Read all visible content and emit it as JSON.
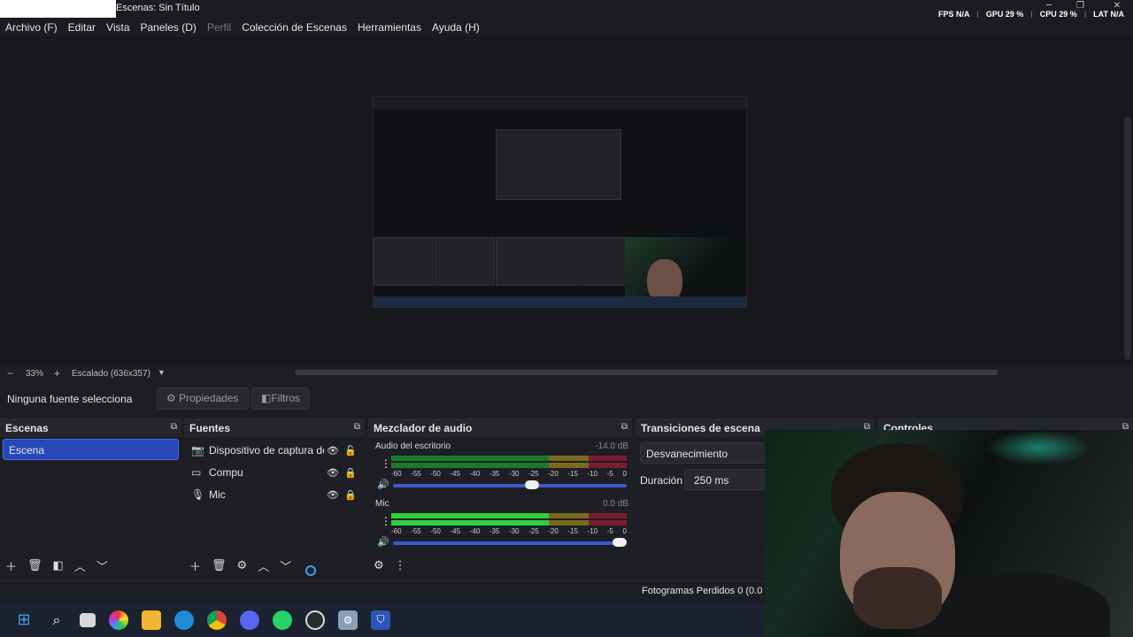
{
  "window": {
    "title": "Escenas: Sin Título"
  },
  "stats": [
    {
      "label": "FPS",
      "value": "N/A"
    },
    {
      "label": "GPU",
      "value": "29 %"
    },
    {
      "label": "CPU",
      "value": "29 %"
    },
    {
      "label": "LAT",
      "value": "N/A"
    }
  ],
  "menu": [
    "Archivo (F)",
    "Editar",
    "Vista",
    "Paneles (D)",
    "Perfil",
    "Colección de Escenas",
    "Herramientas",
    "Ayuda (H)"
  ],
  "zoom": {
    "minus": "−",
    "value": "33%",
    "plus": "+",
    "scale_label": "Escalado (636x357)"
  },
  "props": {
    "no_source": "Ninguna fuente selecciona",
    "properties": "Propiedades",
    "filters": "Filtros"
  },
  "scenes": {
    "title": "Escenas",
    "items": [
      "Escena"
    ]
  },
  "sources": {
    "title": "Fuentes",
    "items": [
      {
        "label": "Dispositivo de captura de",
        "icon": "camera-icon"
      },
      {
        "label": "Compu",
        "icon": "monitor-icon"
      },
      {
        "label": "Mic",
        "icon": "microphone-icon"
      }
    ]
  },
  "mixer": {
    "title": "Mezclador de audio",
    "channels": [
      {
        "name": "Audio del escritorio",
        "db": "-14.0 dB",
        "level": 0.6
      },
      {
        "name": "Mic",
        "db": "0.0 dB",
        "level": 1.0
      }
    ],
    "scale": [
      "-60",
      "-55",
      "-50",
      "-45",
      "-40",
      "-35",
      "-30",
      "-25",
      "-20",
      "-15",
      "-10",
      "-5",
      "0"
    ]
  },
  "transitions": {
    "title": "Transiciones de escena",
    "selected": "Desvanecimiento",
    "duration_label": "Duración",
    "duration_value": "250 ms"
  },
  "controls": {
    "title": "Controles"
  },
  "status": {
    "dropped": "Fotogramas Perdidos 0 (0.0"
  },
  "colors": {
    "accent": "#2847b8",
    "background": "#1d1e23",
    "meter_green": "#2fd13f",
    "meter_yellow": "#7a6a1d",
    "meter_red": "#7a1d2e"
  }
}
